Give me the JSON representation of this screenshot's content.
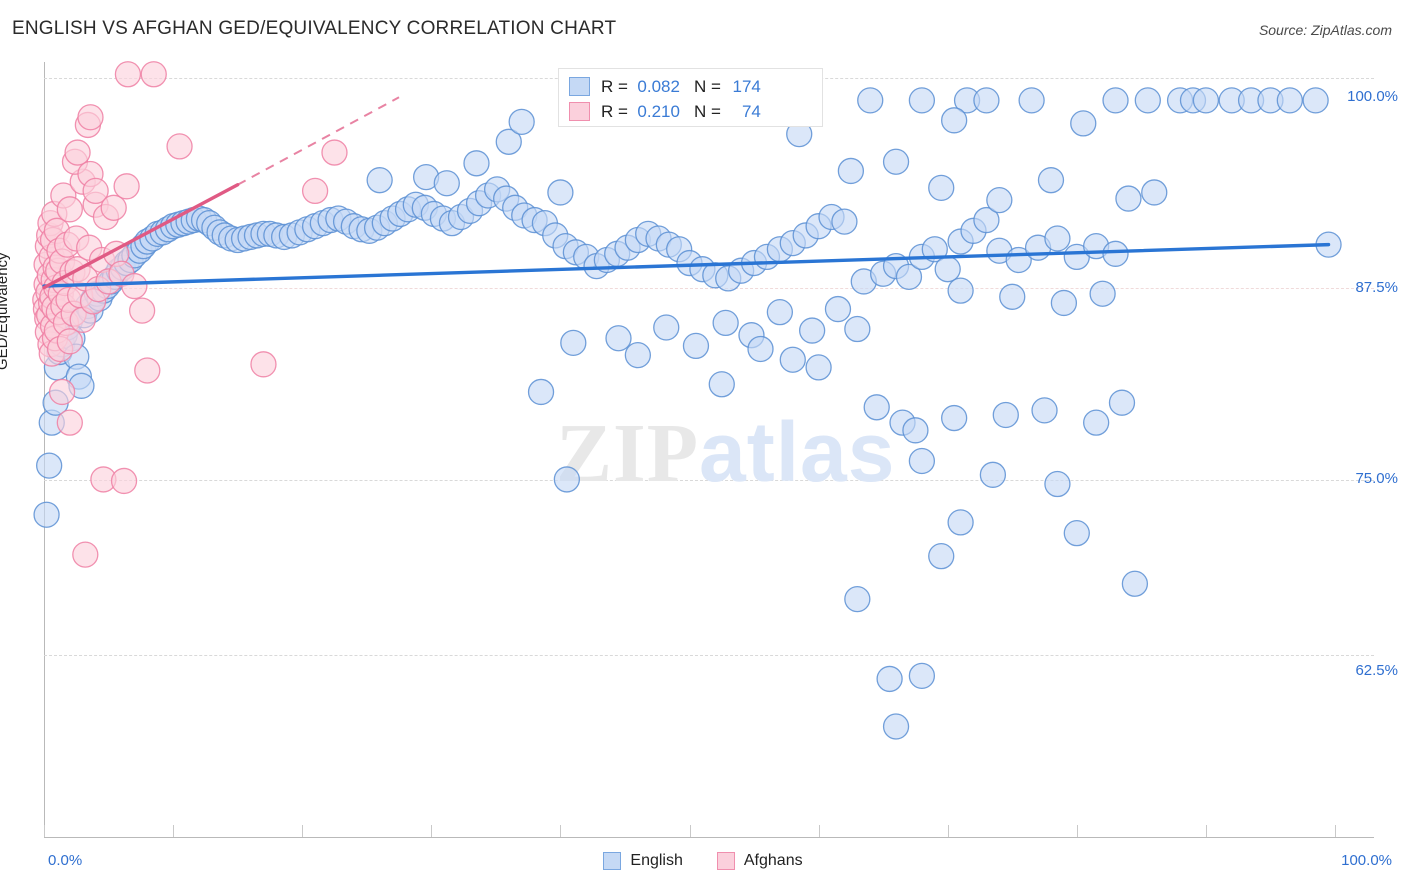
{
  "header": {
    "title": "ENGLISH VS AFGHAN GED/EQUIVALENCY CORRELATION CHART",
    "source": "Source: ZipAtlas.com"
  },
  "watermark": {
    "part1": "ZIP",
    "part2": "atlas"
  },
  "stat_legend": {
    "rows": [
      {
        "series": "English",
        "r_label": "R =",
        "r_value": "0.082",
        "n_label": "N =",
        "n_value": "174",
        "color": "#c5d9f5"
      },
      {
        "series": "Afghans",
        "r_label": "R =",
        "r_value": "0.210",
        "n_label": "N =",
        "n_value": "74",
        "color": "#fbd0dc"
      }
    ]
  },
  "series_legend": [
    {
      "label": "English",
      "color": "#c5d9f5",
      "border": "#7aa7e0"
    },
    {
      "label": "Afghans",
      "color": "#fbd0dc",
      "border": "#f08fae"
    }
  ],
  "axes": {
    "y_label": "GED/Equivalency",
    "y_ticks": [
      "100.0%",
      "87.5%",
      "75.0%",
      "62.5%"
    ],
    "x_ticks": [
      "0.0%",
      "100.0%"
    ]
  },
  "chart_data": {
    "type": "scatter",
    "title": "ENGLISH VS AFGHAN GED/EQUIVALENCY CORRELATION CHART",
    "xlabel": "",
    "ylabel": "GED/Equivalency",
    "xlim": [
      0,
      100
    ],
    "ylim": [
      52.0,
      102.5
    ],
    "grid": true,
    "y_tick_values": [
      100.0,
      87.5,
      75.0,
      62.5
    ],
    "x_tick_values": [
      0.0,
      100.0
    ],
    "legend_position": "bottom-center",
    "series": [
      {
        "name": "English",
        "color": "#c5d9f5",
        "edge": "#5b8fd4",
        "R": 0.082,
        "N": 174,
        "trend": {
          "x0": 0.0,
          "y0": 87.9,
          "x1": 99.5,
          "y1": 90.6,
          "style": "solid"
        },
        "points": [
          [
            0.2,
            73.0
          ],
          [
            0.4,
            76.2
          ],
          [
            0.6,
            79.0
          ],
          [
            0.9,
            80.3
          ],
          [
            1.0,
            82.6
          ],
          [
            1.2,
            83.6
          ],
          [
            1.4,
            84.1
          ],
          [
            1.6,
            84.7
          ],
          [
            1.8,
            85.2
          ],
          [
            2.0,
            85.6
          ],
          [
            2.2,
            84.5
          ],
          [
            2.5,
            83.3
          ],
          [
            2.7,
            82.0
          ],
          [
            2.9,
            81.4
          ],
          [
            3.1,
            86.0
          ],
          [
            3.4,
            86.6
          ],
          [
            3.6,
            86.3
          ],
          [
            3.8,
            87.0
          ],
          [
            4.1,
            87.4
          ],
          [
            4.3,
            87.1
          ],
          [
            4.6,
            87.6
          ],
          [
            4.9,
            87.9
          ],
          [
            5.2,
            88.2
          ],
          [
            5.5,
            88.5
          ],
          [
            5.8,
            88.9
          ],
          [
            6.1,
            89.1
          ],
          [
            6.4,
            89.4
          ],
          [
            6.7,
            89.6
          ],
          [
            7.0,
            89.9
          ],
          [
            7.4,
            90.2
          ],
          [
            7.7,
            90.5
          ],
          [
            8.0,
            90.8
          ],
          [
            8.4,
            91.0
          ],
          [
            8.8,
            91.3
          ],
          [
            9.2,
            91.4
          ],
          [
            9.6,
            91.6
          ],
          [
            10.0,
            91.8
          ],
          [
            10.4,
            91.9
          ],
          [
            10.8,
            92.0
          ],
          [
            11.2,
            92.1
          ],
          [
            11.6,
            92.2
          ],
          [
            12.0,
            92.3
          ],
          [
            12.4,
            92.2
          ],
          [
            12.8,
            92.0
          ],
          [
            13.2,
            91.7
          ],
          [
            13.6,
            91.4
          ],
          [
            14.0,
            91.2
          ],
          [
            14.5,
            91.0
          ],
          [
            15.0,
            90.9
          ],
          [
            15.5,
            91.0
          ],
          [
            16.0,
            91.1
          ],
          [
            16.5,
            91.2
          ],
          [
            17.0,
            91.3
          ],
          [
            17.5,
            91.3
          ],
          [
            18.0,
            91.2
          ],
          [
            18.6,
            91.1
          ],
          [
            19.2,
            91.2
          ],
          [
            19.8,
            91.4
          ],
          [
            20.4,
            91.6
          ],
          [
            21.0,
            91.8
          ],
          [
            21.6,
            92.0
          ],
          [
            22.2,
            92.2
          ],
          [
            22.8,
            92.3
          ],
          [
            23.4,
            92.1
          ],
          [
            24.0,
            91.8
          ],
          [
            24.6,
            91.6
          ],
          [
            25.2,
            91.5
          ],
          [
            25.8,
            91.7
          ],
          [
            26.4,
            92.0
          ],
          [
            27.0,
            92.3
          ],
          [
            27.6,
            92.6
          ],
          [
            28.2,
            92.9
          ],
          [
            28.8,
            93.2
          ],
          [
            29.5,
            93.0
          ],
          [
            30.2,
            92.6
          ],
          [
            30.9,
            92.3
          ],
          [
            31.6,
            92.0
          ],
          [
            32.3,
            92.4
          ],
          [
            33.0,
            92.8
          ],
          [
            33.7,
            93.3
          ],
          [
            34.4,
            93.8
          ],
          [
            35.1,
            94.2
          ],
          [
            35.8,
            93.6
          ],
          [
            36.5,
            93.0
          ],
          [
            37.2,
            92.5
          ],
          [
            38.0,
            92.2
          ],
          [
            38.8,
            92.0
          ],
          [
            39.6,
            91.2
          ],
          [
            40.4,
            90.5
          ],
          [
            41.2,
            90.1
          ],
          [
            42.0,
            89.8
          ],
          [
            42.8,
            89.2
          ],
          [
            33.5,
            95.9
          ],
          [
            36.0,
            97.3
          ],
          [
            40.0,
            94.0
          ],
          [
            29.6,
            95.0
          ],
          [
            31.2,
            94.6
          ],
          [
            26.0,
            94.8
          ],
          [
            43.6,
            89.6
          ],
          [
            44.4,
            90.0
          ],
          [
            45.2,
            90.4
          ],
          [
            46.0,
            90.9
          ],
          [
            46.8,
            91.3
          ],
          [
            47.6,
            91.0
          ],
          [
            48.4,
            90.6
          ],
          [
            49.2,
            90.3
          ],
          [
            50.0,
            89.4
          ],
          [
            51.0,
            89.0
          ],
          [
            52.0,
            88.6
          ],
          [
            53.0,
            88.4
          ],
          [
            54.0,
            88.9
          ],
          [
            55.0,
            89.4
          ],
          [
            56.0,
            89.8
          ],
          [
            57.0,
            90.3
          ],
          [
            58.0,
            90.7
          ],
          [
            59.0,
            91.2
          ],
          [
            60.0,
            91.8
          ],
          [
            61.0,
            92.4
          ],
          [
            62.0,
            92.1
          ],
          [
            44.5,
            84.5
          ],
          [
            48.2,
            85.2
          ],
          [
            50.5,
            84.0
          ],
          [
            52.8,
            85.5
          ],
          [
            54.8,
            84.7
          ],
          [
            57.0,
            86.2
          ],
          [
            59.5,
            85.0
          ],
          [
            61.5,
            86.4
          ],
          [
            63.0,
            85.1
          ],
          [
            41.0,
            84.2
          ],
          [
            46.0,
            83.4
          ],
          [
            55.5,
            83.8
          ],
          [
            58.0,
            83.1
          ],
          [
            60.0,
            82.6
          ],
          [
            63.5,
            88.2
          ],
          [
            65.0,
            88.7
          ],
          [
            66.0,
            89.2
          ],
          [
            67.0,
            88.5
          ],
          [
            68.0,
            89.8
          ],
          [
            69.0,
            90.3
          ],
          [
            70.0,
            89.0
          ],
          [
            71.0,
            90.8
          ],
          [
            72.0,
            91.5
          ],
          [
            73.0,
            92.2
          ],
          [
            74.0,
            90.2
          ],
          [
            75.5,
            89.6
          ],
          [
            77.0,
            90.4
          ],
          [
            78.5,
            91.0
          ],
          [
            80.0,
            89.8
          ],
          [
            81.5,
            90.5
          ],
          [
            83.0,
            90.0
          ],
          [
            71.0,
            87.6
          ],
          [
            75.0,
            87.2
          ],
          [
            79.0,
            86.8
          ],
          [
            82.0,
            87.4
          ],
          [
            62.5,
            95.4
          ],
          [
            66.0,
            96.0
          ],
          [
            69.5,
            94.3
          ],
          [
            74.0,
            93.5
          ],
          [
            78.0,
            94.8
          ],
          [
            84.0,
            93.6
          ],
          [
            86.0,
            94.0
          ],
          [
            58.5,
            97.8
          ],
          [
            37.0,
            98.6
          ],
          [
            64.0,
            100.0
          ],
          [
            68.0,
            100.0
          ],
          [
            71.5,
            100.0
          ],
          [
            73.0,
            100.0
          ],
          [
            76.5,
            100.0
          ],
          [
            83.0,
            100.0
          ],
          [
            85.5,
            100.0
          ],
          [
            88.0,
            100.0
          ],
          [
            89.0,
            100.0
          ],
          [
            90.0,
            100.0
          ],
          [
            92.0,
            100.0
          ],
          [
            93.5,
            100.0
          ],
          [
            95.0,
            100.0
          ],
          [
            96.5,
            100.0
          ],
          [
            98.5,
            100.0
          ],
          [
            80.5,
            98.5
          ],
          [
            70.5,
            98.7
          ],
          [
            99.5,
            90.6
          ],
          [
            66.5,
            79.0
          ],
          [
            67.5,
            78.5
          ],
          [
            70.5,
            79.3
          ],
          [
            74.5,
            79.5
          ],
          [
            77.5,
            79.8
          ],
          [
            81.5,
            79.0
          ],
          [
            83.5,
            80.3
          ],
          [
            64.5,
            80.0
          ],
          [
            68.0,
            76.5
          ],
          [
            73.5,
            75.6
          ],
          [
            78.5,
            75.0
          ],
          [
            71.0,
            72.5
          ],
          [
            69.5,
            70.3
          ],
          [
            80.0,
            71.8
          ],
          [
            84.5,
            68.5
          ],
          [
            63.0,
            67.5
          ],
          [
            65.5,
            62.3
          ],
          [
            68.0,
            62.5
          ],
          [
            66.0,
            59.2
          ],
          [
            52.5,
            81.5
          ],
          [
            40.5,
            75.3
          ],
          [
            38.5,
            81.0
          ]
        ]
      },
      {
        "name": "Afghans",
        "color": "#fbd0dc",
        "edge": "#ee7fa3",
        "R": 0.21,
        "N": 74,
        "trend": {
          "x0": 0.0,
          "y0": 87.8,
          "x1": 15.0,
          "y1": 94.5,
          "style": "solid"
        },
        "trend_dashed": {
          "x0": 15.0,
          "y0": 94.5,
          "x1": 27.5,
          "y1": 100.2,
          "style": "dashed"
        },
        "points": [
          [
            0.1,
            87.0
          ],
          [
            0.15,
            86.4
          ],
          [
            0.2,
            88.0
          ],
          [
            0.2,
            89.3
          ],
          [
            0.25,
            85.8
          ],
          [
            0.3,
            90.5
          ],
          [
            0.3,
            84.9
          ],
          [
            0.35,
            87.5
          ],
          [
            0.4,
            91.2
          ],
          [
            0.4,
            86.0
          ],
          [
            0.45,
            88.6
          ],
          [
            0.5,
            84.1
          ],
          [
            0.5,
            92.0
          ],
          [
            0.55,
            86.8
          ],
          [
            0.6,
            89.8
          ],
          [
            0.6,
            83.5
          ],
          [
            0.65,
            87.2
          ],
          [
            0.7,
            90.9
          ],
          [
            0.7,
            85.3
          ],
          [
            0.75,
            88.3
          ],
          [
            0.8,
            92.6
          ],
          [
            0.8,
            86.5
          ],
          [
            0.85,
            84.5
          ],
          [
            0.9,
            89.1
          ],
          [
            0.95,
            87.8
          ],
          [
            1.0,
            91.5
          ],
          [
            1.0,
            85.0
          ],
          [
            1.1,
            88.9
          ],
          [
            1.15,
            86.2
          ],
          [
            1.2,
            90.2
          ],
          [
            1.25,
            83.8
          ],
          [
            1.3,
            87.4
          ],
          [
            1.4,
            89.5
          ],
          [
            1.5,
            86.6
          ],
          [
            1.5,
            93.8
          ],
          [
            1.6,
            88.1
          ],
          [
            1.7,
            85.5
          ],
          [
            1.8,
            90.6
          ],
          [
            1.9,
            87.0
          ],
          [
            2.0,
            92.9
          ],
          [
            2.0,
            84.3
          ],
          [
            2.2,
            88.8
          ],
          [
            2.3,
            86.1
          ],
          [
            2.5,
            91.0
          ],
          [
            2.6,
            89.0
          ],
          [
            2.8,
            87.3
          ],
          [
            3.0,
            94.7
          ],
          [
            3.0,
            85.7
          ],
          [
            3.2,
            88.4
          ],
          [
            3.5,
            90.4
          ],
          [
            3.8,
            86.9
          ],
          [
            4.0,
            93.2
          ],
          [
            4.2,
            87.7
          ],
          [
            4.5,
            89.6
          ],
          [
            4.8,
            92.4
          ],
          [
            5.0,
            88.2
          ],
          [
            2.4,
            96.0
          ],
          [
            2.6,
            96.6
          ],
          [
            3.6,
            95.2
          ],
          [
            4.0,
            94.1
          ],
          [
            5.4,
            93.0
          ],
          [
            5.6,
            90.0
          ],
          [
            6.0,
            88.7
          ],
          [
            6.4,
            94.4
          ],
          [
            7.0,
            87.9
          ],
          [
            7.6,
            86.3
          ],
          [
            3.4,
            98.4
          ],
          [
            3.6,
            98.9
          ],
          [
            6.5,
            101.7
          ],
          [
            8.5,
            101.7
          ],
          [
            10.5,
            97.0
          ],
          [
            4.6,
            75.3
          ],
          [
            6.2,
            75.2
          ],
          [
            3.2,
            70.4
          ],
          [
            22.5,
            96.6
          ],
          [
            21.0,
            94.1
          ],
          [
            17.0,
            82.8
          ],
          [
            8.0,
            82.4
          ],
          [
            2.0,
            79.0
          ],
          [
            1.4,
            81.0
          ]
        ]
      }
    ]
  }
}
